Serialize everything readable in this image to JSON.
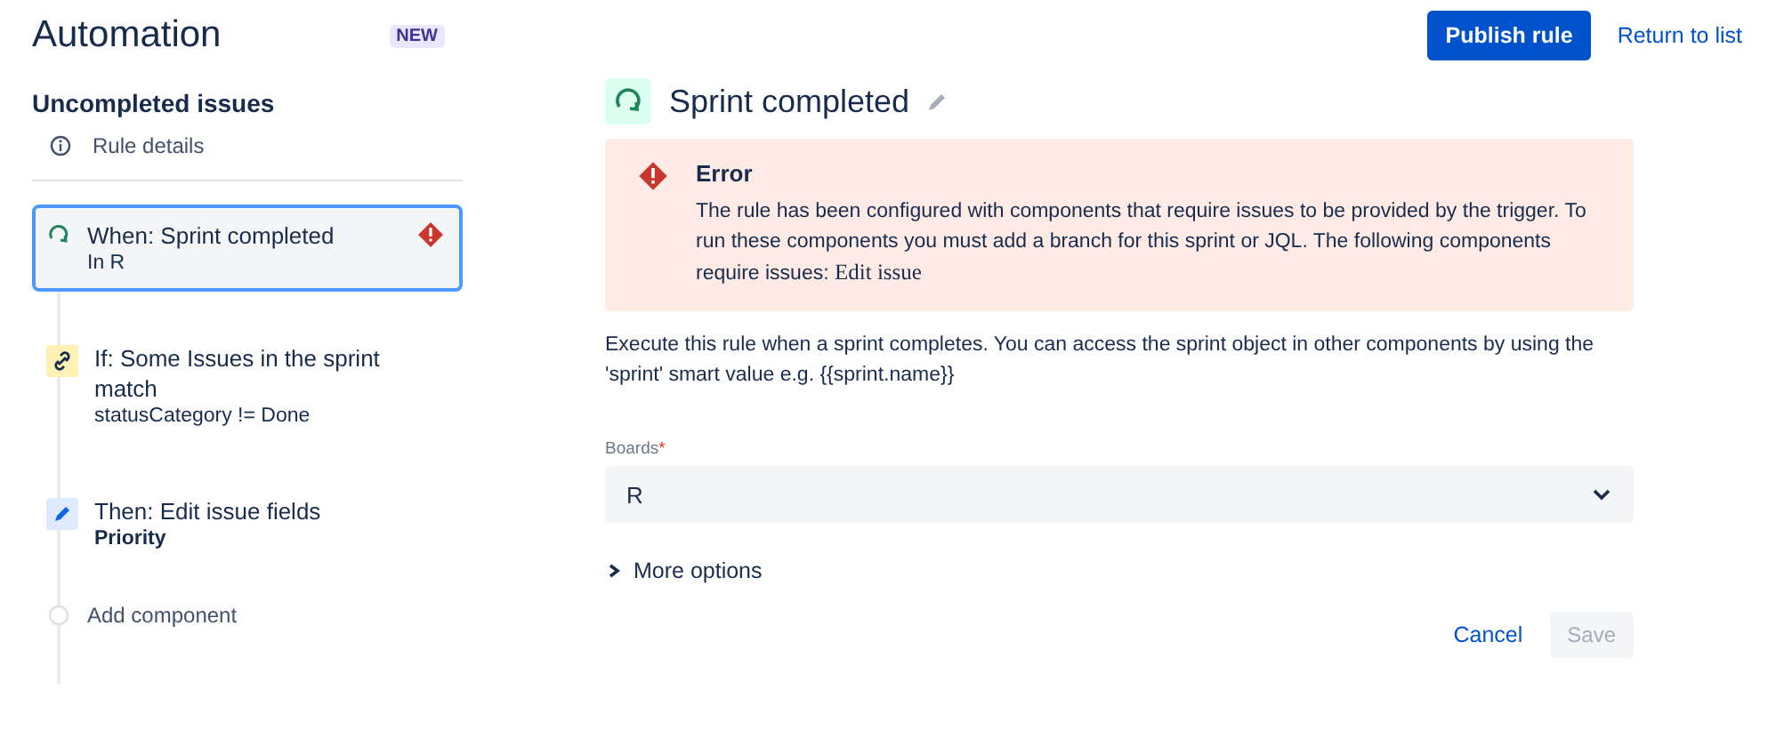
{
  "header": {
    "title": "Automation",
    "badge": "NEW",
    "buttons": [
      {
        "label": "Publish rule",
        "kind": "primary"
      },
      {
        "label": "Return to list",
        "kind": "link"
      }
    ]
  },
  "sidebar": {
    "rule_name": "Uncompleted issues",
    "details": "Rule details",
    "components": [
      {
        "kind": "trigger",
        "title": "When: Sprint completed",
        "subtitle": "In R",
        "subtitle_bold": false,
        "selected": true,
        "error": true
      },
      {
        "kind": "condition",
        "title": "If: Some Issues in the sprint match",
        "subtitle": "statusCategory != Done",
        "subtitle_bold": false,
        "selected": false,
        "error": false
      },
      {
        "kind": "action",
        "title": "Then: Edit issue fields",
        "subtitle": "Priority",
        "subtitle_bold": true,
        "selected": false,
        "error": false
      },
      {
        "kind": "add",
        "title": "Add component"
      }
    ]
  },
  "panel": {
    "title": "Sprint completed",
    "error": {
      "title": "Error",
      "body": "The rule has been configured with components that require issues to be provided by the trigger. To run these components you must add a branch for this sprint or JQL. The following components require issues:",
      "components": "Edit issue"
    },
    "description": "Execute this rule when a sprint completes. You can access the sprint object in other components by using the 'sprint' smart value e.g. {{sprint.name}}",
    "field": {
      "label": "Boards",
      "required_mark": "*",
      "value": "R"
    },
    "more_options": {
      "label": "More options",
      "expanded": false
    },
    "buttons": [
      {
        "label": "Cancel",
        "kind": "link",
        "disabled": false
      },
      {
        "label": "Save",
        "kind": "primary",
        "disabled": true
      }
    ]
  }
}
